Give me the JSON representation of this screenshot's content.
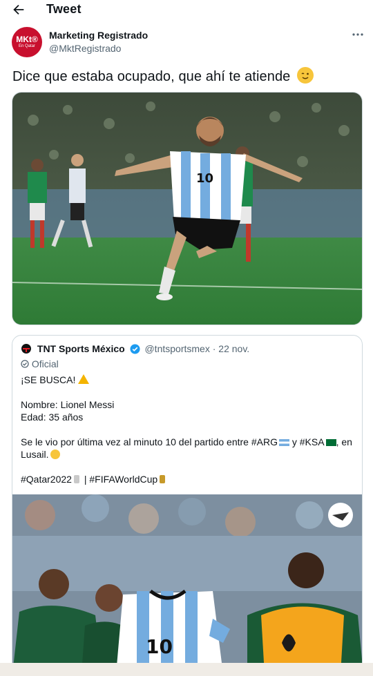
{
  "header": {
    "title": "Tweet",
    "back_icon": "arrow-left-icon"
  },
  "author": {
    "name": "Marketing Registrado",
    "handle": "@MktRegistrado",
    "avatar_text_1": "MKt®",
    "avatar_text_2": "En Qatar",
    "avatar_color": "#c8102e"
  },
  "tweet": {
    "text": "Dice que estaba ocupado, que ahí te atiende",
    "emoji": "winking-face"
  },
  "quote": {
    "name": "TNT Sports México",
    "handle": "@tntsportsmex",
    "sep": "·",
    "date": "22 nov.",
    "affiliation": "Oficial",
    "line1": "¡SE BUSCA!",
    "line2": "Nombre: Lionel Messi",
    "line3": "Edad: 35 años",
    "line4a": "Se le vio por última vez al minuto 10 del partido entre #ARG",
    "line4b": " y #KSA",
    "line4c": ", en",
    "line5": "Lusail.",
    "hashtags_a": "#Qatar2022",
    "hashtags_b": " | #FIFAWorldCup"
  },
  "colors": {
    "verified": "#1d9bf0",
    "muted": "#536471",
    "pitch": "#2f7d3a"
  }
}
